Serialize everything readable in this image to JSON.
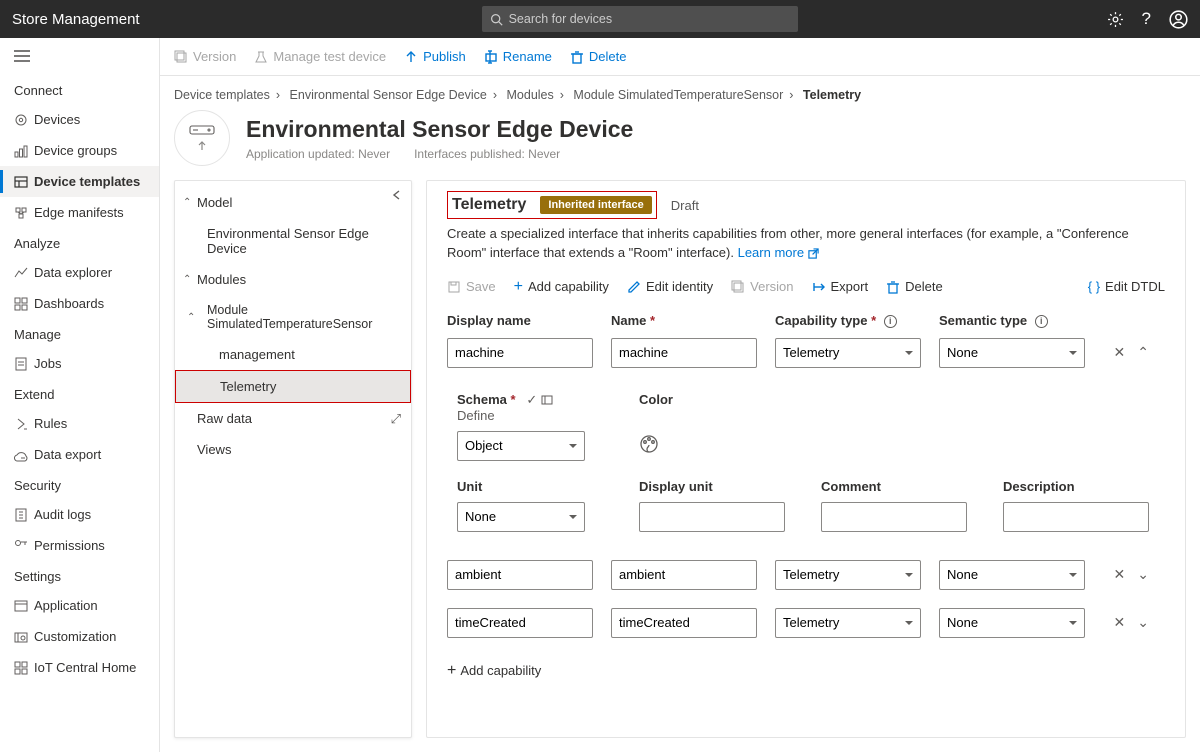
{
  "app": {
    "title": "Store Management"
  },
  "search": {
    "placeholder": "Search for devices"
  },
  "sidebar": {
    "sections": [
      {
        "title": "Connect",
        "items": [
          {
            "label": "Devices"
          },
          {
            "label": "Device groups"
          },
          {
            "label": "Device templates",
            "selected": true
          },
          {
            "label": "Edge manifests"
          }
        ]
      },
      {
        "title": "Analyze",
        "items": [
          {
            "label": "Data explorer"
          },
          {
            "label": "Dashboards"
          }
        ]
      },
      {
        "title": "Manage",
        "items": [
          {
            "label": "Jobs"
          }
        ]
      },
      {
        "title": "Extend",
        "items": [
          {
            "label": "Rules"
          },
          {
            "label": "Data export"
          }
        ]
      },
      {
        "title": "Security",
        "items": [
          {
            "label": "Audit logs"
          },
          {
            "label": "Permissions"
          }
        ]
      },
      {
        "title": "Settings",
        "items": [
          {
            "label": "Application"
          },
          {
            "label": "Customization"
          },
          {
            "label": "IoT Central Home"
          }
        ]
      }
    ]
  },
  "cmdbar": {
    "version": "Version",
    "manage_test": "Manage test device",
    "publish": "Publish",
    "rename": "Rename",
    "delete": "Delete"
  },
  "breadcrumb": {
    "parts": [
      "Device templates",
      "Environmental Sensor Edge Device",
      "Modules",
      "Module SimulatedTemperatureSensor"
    ],
    "current": "Telemetry",
    "sep": "›"
  },
  "header": {
    "title": "Environmental Sensor Edge Device",
    "app_updated": "Application updated: Never",
    "interfaces_pub": "Interfaces published: Never"
  },
  "tree": {
    "model": "Model",
    "device": "Environmental Sensor Edge Device",
    "modules": "Modules",
    "module": "Module SimulatedTemperatureSensor",
    "management": "management",
    "telemetry": "Telemetry",
    "rawdata": "Raw data",
    "views": "Views"
  },
  "detail": {
    "title": "Telemetry",
    "badge": "Inherited interface",
    "status": "Draft",
    "desc_pre": "Create a specialized interface that inherits capabilities from other, more general interfaces (for example, a \"Conference Room\" interface that extends a \"Room\" interface). ",
    "learn_more": "Learn more"
  },
  "actions": {
    "save": "Save",
    "add_cap": "Add capability",
    "edit_identity": "Edit identity",
    "version": "Version",
    "export": "Export",
    "delete": "Delete",
    "edit_dtdl": "Edit DTDL"
  },
  "cols": {
    "display_name": "Display name",
    "name": "Name",
    "cap_type": "Capability type",
    "sem_type": "Semantic type"
  },
  "rows": [
    {
      "display": "machine",
      "name": "machine",
      "cap": "Telemetry",
      "sem": "None",
      "expanded": true
    },
    {
      "display": "ambient",
      "name": "ambient",
      "cap": "Telemetry",
      "sem": "None",
      "expanded": false
    },
    {
      "display": "timeCreated",
      "name": "timeCreated",
      "cap": "Telemetry",
      "sem": "None",
      "expanded": false
    }
  ],
  "expanded": {
    "schema": "Schema",
    "schema_val": "Object",
    "define": "Define",
    "color": "Color",
    "unit": "Unit",
    "unit_val": "None",
    "display_unit": "Display unit",
    "comment": "Comment",
    "description": "Description"
  },
  "add_capability": "Add capability"
}
